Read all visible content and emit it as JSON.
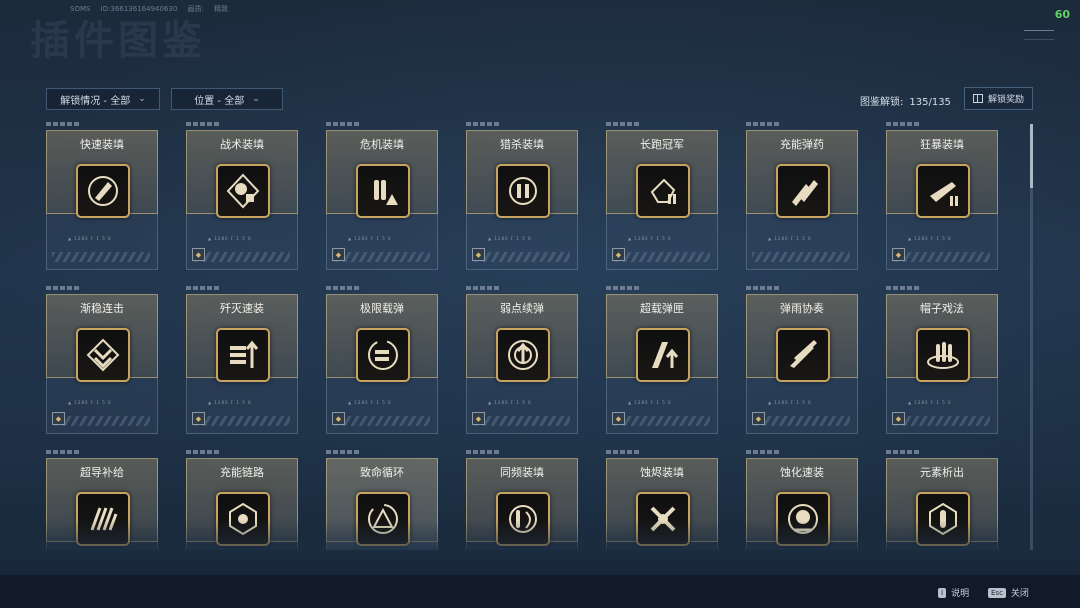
{
  "header": {
    "bg_title": "插件图鉴",
    "info": [
      "SOMS",
      "ID:366136164940630",
      "画质:",
      "精致"
    ],
    "fps": "60"
  },
  "filters": [
    {
      "label": "解锁情况 - 全部"
    },
    {
      "label": "位置 - 全部"
    }
  ],
  "collection": {
    "label": "图鉴解锁:",
    "value": "135/135"
  },
  "reward_button": {
    "label": "解锁奖励"
  },
  "cards": [
    {
      "name": "快速装填",
      "icon": "bullet-reload-icon"
    },
    {
      "name": "战术装填",
      "icon": "tactical-head-icon",
      "badge": true
    },
    {
      "name": "危机装填",
      "icon": "bullets-warning-icon",
      "badge": true
    },
    {
      "name": "猎杀装填",
      "icon": "crosshair-bullets-icon",
      "badge": true
    },
    {
      "name": "长跑冠军",
      "icon": "runner-icon",
      "badge": true
    },
    {
      "name": "充能弹药",
      "icon": "rocket-bullets-icon"
    },
    {
      "name": "狂暴装填",
      "icon": "gun-reload-icon",
      "badge": true
    },
    {
      "name": "渐稳连击",
      "icon": "chevrons-icon",
      "badge": true
    },
    {
      "name": "歼灭速装",
      "icon": "bullets-arrow-icon",
      "badge": true
    },
    {
      "name": "极限载弹",
      "icon": "loop-bullets-icon",
      "badge": true
    },
    {
      "name": "弱点续弹",
      "icon": "target-up-icon",
      "badge": true
    },
    {
      "name": "超载弹匣",
      "icon": "magazine-up-icon",
      "badge": true
    },
    {
      "name": "弹雨协奏",
      "icon": "crossed-bullets-icon",
      "badge": true
    },
    {
      "name": "帽子戏法",
      "icon": "hat-trick-icon",
      "badge": true
    },
    {
      "name": "超导补给",
      "icon": "claw-icon"
    },
    {
      "name": "充能链路",
      "icon": "link-node-icon"
    },
    {
      "name": "致命循环",
      "icon": "deadly-loop-icon",
      "active": true
    },
    {
      "name": "同频装填",
      "icon": "sync-reload-icon"
    },
    {
      "name": "蚀烬装填",
      "icon": "burn-cross-icon"
    },
    {
      "name": "蚀化速装",
      "icon": "corrode-icon"
    },
    {
      "name": "元素析出",
      "icon": "element-icon"
    }
  ],
  "card_subtext": "▲ 1280 F 1 5 0",
  "hints": [
    {
      "key": "I",
      "label": "说明"
    },
    {
      "key": "Esc",
      "label": "关闭"
    }
  ],
  "colors": {
    "gold": "#c8a460",
    "panel": "#21354c",
    "fps": "#5fd55f"
  }
}
